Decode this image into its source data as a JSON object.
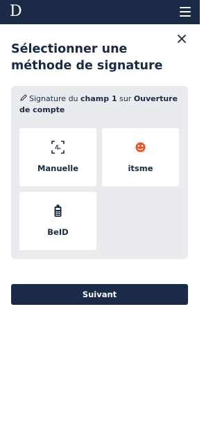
{
  "header": {
    "logo": "D",
    "menu_icon": "hamburger-icon"
  },
  "dialog": {
    "close_icon": "close-icon",
    "title": "Sélectionner une méthode de signature",
    "info": {
      "prefix": "Signature du ",
      "field": "champ 1",
      "middle": " sur ",
      "document": "Ouverture de compte"
    },
    "methods": [
      {
        "label": "Manuelle",
        "icon": "signature-scan-icon"
      },
      {
        "label": "itsme",
        "icon": "itsme-icon",
        "color": "#e8521f"
      },
      {
        "label": "BeID",
        "icon": "card-reader-icon"
      }
    ],
    "next_label": "Suivant"
  },
  "colors": {
    "navy": "#1b2a47",
    "panel": "#e9ebee",
    "itsme_orange": "#e8521f"
  }
}
